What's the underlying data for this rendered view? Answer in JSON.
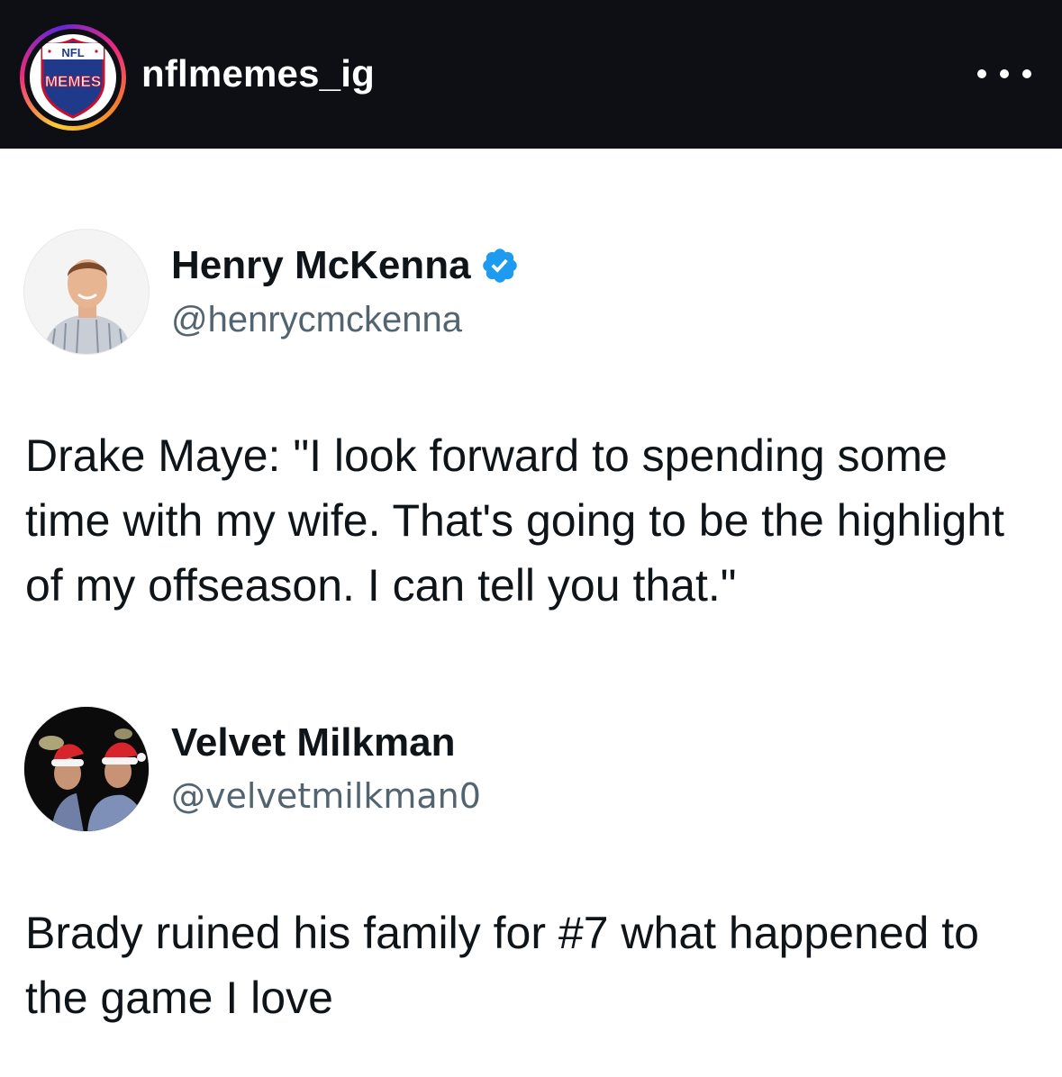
{
  "ig_header": {
    "username": "nflmemes_ig",
    "avatar_logo_text_top": "NFL",
    "avatar_logo_text_main": "MEMES",
    "more_icon": "ellipsis-icon"
  },
  "tweets": [
    {
      "author_name": "Henry McKenna",
      "handle": "@henrycmckenna",
      "verified": true,
      "text": "Drake Maye: \"I look forward to spending some time with my wife. That's going to be the highlight of my offseason. I can tell you that.\""
    },
    {
      "author_name": "Velvet Milkman",
      "handle": "@velvetmilkman0",
      "verified": false,
      "text": "Brady ruined his family for #7 what happened to the game I love"
    }
  ],
  "colors": {
    "header_bg": "#0d0f14",
    "verified_blue": "#1d9bf0",
    "handle_gray": "#536471",
    "text_black": "#0f1419"
  }
}
